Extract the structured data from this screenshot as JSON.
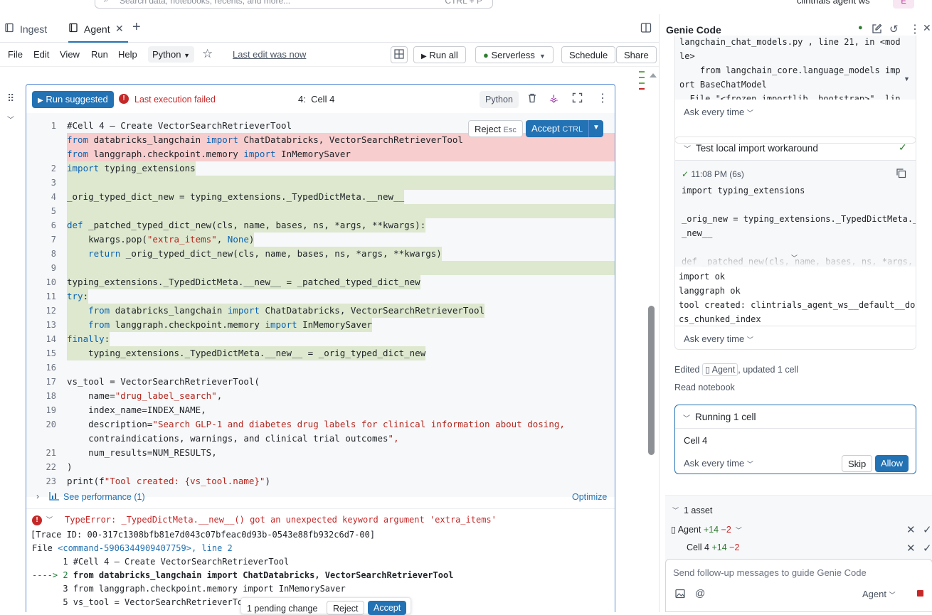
{
  "search": {
    "placeholder": "Search data, notebooks, recents, and more...",
    "shortcut": "CTRL + P"
  },
  "workspace": {
    "name": "clintrials agent ws",
    "avatar": "E"
  },
  "tabs": [
    {
      "label": "Ingest"
    },
    {
      "label": "Agent"
    }
  ],
  "menu": {
    "items": [
      "File",
      "Edit",
      "View",
      "Run",
      "Help"
    ],
    "language": "Python",
    "last_edit": "Last edit was now"
  },
  "toolbar": {
    "run_all": "Run all",
    "compute": "Serverless",
    "schedule": "Schedule",
    "share": "Share"
  },
  "cell": {
    "run_suggested": "Run suggested",
    "status": "Last execution failed",
    "title": "4:  Cell 4",
    "language": "Python",
    "reject": "Reject",
    "reject_key": "Esc",
    "accept": "Accept",
    "accept_key": "CTRL",
    "see_performance": "See performance (1)",
    "optimize": "Optimize"
  },
  "code_lines": [
    {
      "n": "1",
      "t": "#Cell 4 — Create VectorSearchRetrieverTool",
      "bg": "none"
    },
    {
      "n": "",
      "t": "from databricks_langchain import ChatDatabricks, VectorSearchRetrieverTool",
      "bg": "del"
    },
    {
      "n": "",
      "t": "from langgraph.checkpoint.memory import InMemorySaver",
      "bg": "del"
    },
    {
      "n": "2",
      "t": "import typing_extensions",
      "bg": "add"
    },
    {
      "n": "3",
      "t": "",
      "bg": "add"
    },
    {
      "n": "4",
      "t": "_orig_typed_dict_new = typing_extensions._TypedDictMeta.__new__",
      "bg": "add"
    },
    {
      "n": "5",
      "t": "",
      "bg": "add"
    },
    {
      "n": "6",
      "t": "def _patched_typed_dict_new(cls, name, bases, ns, *args, **kwargs):",
      "bg": "add"
    },
    {
      "n": "7",
      "t": "    kwargs.pop(\"extra_items\", None)",
      "bg": "add"
    },
    {
      "n": "8",
      "t": "    return _orig_typed_dict_new(cls, name, bases, ns, *args, **kwargs)",
      "bg": "add"
    },
    {
      "n": "9",
      "t": "",
      "bg": "add"
    },
    {
      "n": "10",
      "t": "typing_extensions._TypedDictMeta.__new__ = _patched_typed_dict_new",
      "bg": "add"
    },
    {
      "n": "11",
      "t": "try:",
      "bg": "add"
    },
    {
      "n": "12",
      "t": "    from databricks_langchain import ChatDatabricks, VectorSearchRetrieverTool",
      "bg": "add"
    },
    {
      "n": "13",
      "t": "    from langgraph.checkpoint.memory import InMemorySaver",
      "bg": "add"
    },
    {
      "n": "14",
      "t": "finally:",
      "bg": "add"
    },
    {
      "n": "15",
      "t": "    typing_extensions._TypedDictMeta.__new__ = _orig_typed_dict_new",
      "bg": "add"
    },
    {
      "n": "16",
      "t": "",
      "bg": "none"
    },
    {
      "n": "17",
      "t": "vs_tool = VectorSearchRetrieverTool(",
      "bg": "none"
    },
    {
      "n": "18",
      "t": "    name=\"drug_label_search\",",
      "bg": "none"
    },
    {
      "n": "19",
      "t": "    index_name=INDEX_NAME,",
      "bg": "none"
    },
    {
      "n": "20",
      "t": "    description=\"Search GLP-1 and diabetes drug labels for clinical information about dosing,",
      "bg": "none"
    },
    {
      "n": "",
      "t": "    contraindications, warnings, and clinical trial outcomes\",",
      "bg": "none"
    },
    {
      "n": "21",
      "t": "    num_results=NUM_RESULTS,",
      "bg": "none"
    },
    {
      "n": "22",
      "t": ")",
      "bg": "none"
    },
    {
      "n": "23",
      "t": "print(f\"Tool created: {vs_tool.name}\")",
      "bg": "none"
    }
  ],
  "output": {
    "error": "TypeError: _TypedDictMeta.__new__() got an unexpected keyword argument 'extra_items'",
    "trace": "[Trace ID: 00-317c1308bfb81e7d043c07bfeac0d93b-0543e88fb932c6d7-00]",
    "file_prefix": "File ",
    "file_link": "<command-5906344909407759>, line 2",
    "l1": "      1 #Cell 4 — Create VectorSearchRetrieverTool",
    "l2_arrow": "----> 2 ",
    "l2": "from databricks_langchain import ChatDatabricks, VectorSearchRetrieverTool",
    "l3": "      3 from langgraph.checkpoint.memory import InMemorySaver",
    "l5": "      5 vs_tool = VectorSearchRetrieverToc"
  },
  "pending": {
    "label": "1 pending change",
    "reject": "Reject",
    "accept": "Accept"
  },
  "genie": {
    "title": "Genie Code",
    "top_code": "langchain_chat_models.py , line 21, in <mod\nle>\n    from langchain_core.language_models imp\nort BaseChatModel\n  File \"<frozen importlib._bootstrap>\", lin",
    "ask_every_time": "Ask every time",
    "step_title": "Test local import workaround",
    "step_time": "11:08 PM (6s)",
    "step_code": "import typing_extensions\n\n_orig_new = typing_extensions._TypedDictMeta._\n_new__\n\ndef _patched_new(cls, name, bases, ns, *args,",
    "step_output": "import ok\nlanggraph ok\ntool created: clintrials_agent_ws__default__do\ncs_chunked_index",
    "edited_prefix": "Edited",
    "edited_name": "Agent",
    "edited_suffix": ", updated 1 cell",
    "read_notebook": "Read notebook",
    "running": "Running 1 cell",
    "running_cell": "Cell 4",
    "skip": "Skip",
    "allow": "Allow",
    "assets_title": "1 asset",
    "asset1_name": "Agent",
    "asset2_name": "Cell 4",
    "diff_add": "+14",
    "diff_del": "−2",
    "input_placeholder": "Send follow-up messages to guide Genie Code",
    "mode": "Agent"
  },
  "colors": {
    "accent": "#2272b4",
    "error": "#c62828",
    "added": "#dde8cf",
    "deleted": "#f7cdcd",
    "success": "#2e7d32"
  }
}
